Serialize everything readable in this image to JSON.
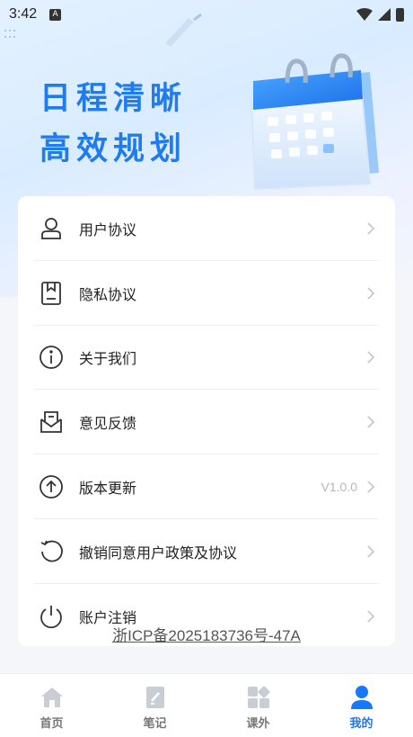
{
  "statusbar": {
    "time": "3:42",
    "badge": "A"
  },
  "hero": {
    "line1": "日程清晰",
    "line2": "高效规划"
  },
  "menu": [
    {
      "label": "用户协议",
      "icon": "user-agreement-icon"
    },
    {
      "label": "隐私协议",
      "icon": "privacy-document-icon"
    },
    {
      "label": "关于我们",
      "icon": "info-icon"
    },
    {
      "label": "意见反馈",
      "icon": "feedback-mail-icon"
    },
    {
      "label": "版本更新",
      "icon": "upload-arrow-icon",
      "value": "V1.0.0"
    },
    {
      "label": "撤销同意用户政策及协议",
      "icon": "undo-icon"
    },
    {
      "label": "账户注销",
      "icon": "power-icon"
    }
  ],
  "icp": "浙ICP备2025183736号-47A",
  "tabs": [
    {
      "label": "首页",
      "icon": "home-icon"
    },
    {
      "label": "笔记",
      "icon": "notes-icon"
    },
    {
      "label": "课外",
      "icon": "apps-icon"
    },
    {
      "label": "我的",
      "icon": "profile-icon",
      "active": true
    }
  ],
  "colors": {
    "accent": "#1677ff",
    "title": "#1f7cf0",
    "inactive_tab": "#c9cdd4"
  }
}
